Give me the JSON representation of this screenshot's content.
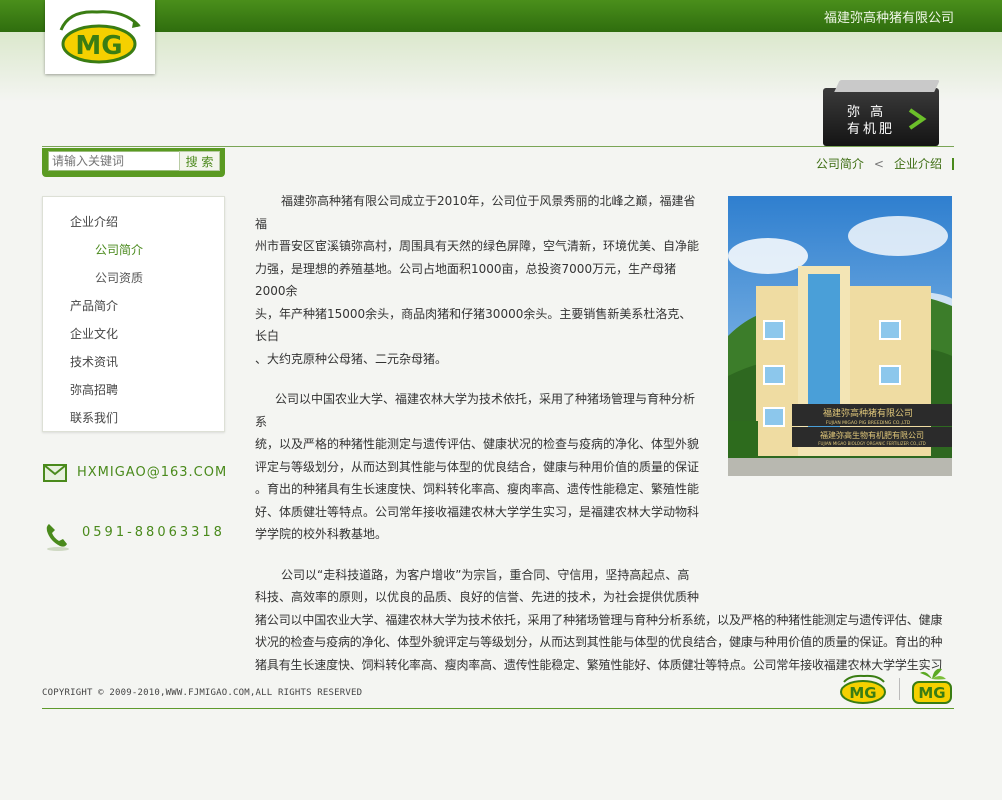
{
  "header": {
    "company_name": "福建弥高种猪有限公司",
    "logo_text": "MG",
    "fertilizer_tab": {
      "line1": "弥  高",
      "line2": "有机肥"
    }
  },
  "search": {
    "placeholder": "请输入关键词",
    "button_label": "搜 索"
  },
  "breadcrumb": {
    "items": [
      "公司简介",
      "企业介绍"
    ],
    "separator": "<"
  },
  "sidebar": {
    "items": [
      {
        "label": "企业介绍",
        "level": 1
      },
      {
        "label": "公司简介",
        "level": 2,
        "active": true
      },
      {
        "label": "公司资质",
        "level": 2
      },
      {
        "label": "产品简介",
        "level": 1
      },
      {
        "label": "企业文化",
        "level": 1
      },
      {
        "label": "技术资讯",
        "level": 1
      },
      {
        "label": "弥高招聘",
        "level": 1
      },
      {
        "label": "联系我们",
        "level": 1
      }
    ]
  },
  "contact": {
    "email": "HXMIGAO@163.COM",
    "phone": "0591-88063318"
  },
  "content": {
    "p1_lines": [
      "福建弥高种猪有限公司成立于2010年，公司位于风景秀丽的北峰之巅，福建省福",
      "州市晋安区宦溪镇弥高村，周围具有天然的绿色屏障，空气清新，环境优美、自净能",
      "力强，是理想的养殖基地。公司占地面积1000亩，总投资7000万元，生产母猪2000余",
      "头，年产种猪15000余头，商品肉猪和仔猪30000余头。主要销售新美系杜洛克、长白",
      "、大约克原种公母猪、二元杂母猪。"
    ],
    "p2_lines": [
      "公司以中国农业大学、福建农林大学为技术依托，采用了种猪场管理与育种分析系",
      "统，以及严格的种猪性能测定与遗传评估、健康状况的检查与疫病的净化、体型外貌",
      "评定与等级划分，从而达到其性能与体型的优良结合，健康与种用价值的质量的保证",
      "。育出的种猪具有生长速度快、饲料转化率高、瘦肉率高、遗传性能稳定、繁殖性能",
      "好、体质健壮等特点。公司常年接收福建农林大学学生实习，是福建农林大学动物科",
      "学学院的校外科教基地。"
    ],
    "p3_lines": [
      "公司以“走科技道路，为客户增收”为宗旨，重合同、守信用，坚持高起点、高",
      "科技、高效率的原则，以优良的品质、良好的信誉、先进的技术，为社会提供优质种",
      "猪公司以中国农业大学、福建农林大学为技术依托，采用了种猪场管理与育种分析系统，以及严格的种猪性能测定与遗传评估、健康",
      "状况的检查与疫病的净化、体型外貌评定与等级划分，从而达到其性能与体型的优良结合，健康与种用价值的质量的保证。育出的种",
      "猪具有生长速度快、饲料转化率高、瘦肉率高、遗传性能稳定、繁殖性能好、体质健壮等特点。公司常年接收福建农林大学学生实习"
    ],
    "photo_sign_cn": "福建弥高种猪有限公司",
    "photo_sign_en": "FUJIAN MIGAO PIG BREEDING CO.,LTD",
    "photo_sign2_cn": "福建弥高生物有机肥有限公司",
    "photo_sign2_en": "FUJIAN MIGAO BIOLOGY ORGANIC FERTILIZER CO.,LTD"
  },
  "footer": {
    "copyright": "COPYRIGHT © 2009-2010,WWW.FJMIGAO.COM,ALL RIGHTS RESERVED"
  },
  "colors": {
    "brand_green": "#4a8a1c",
    "header_green": "#3a7d13",
    "logo_yellow": "#f5d000"
  }
}
